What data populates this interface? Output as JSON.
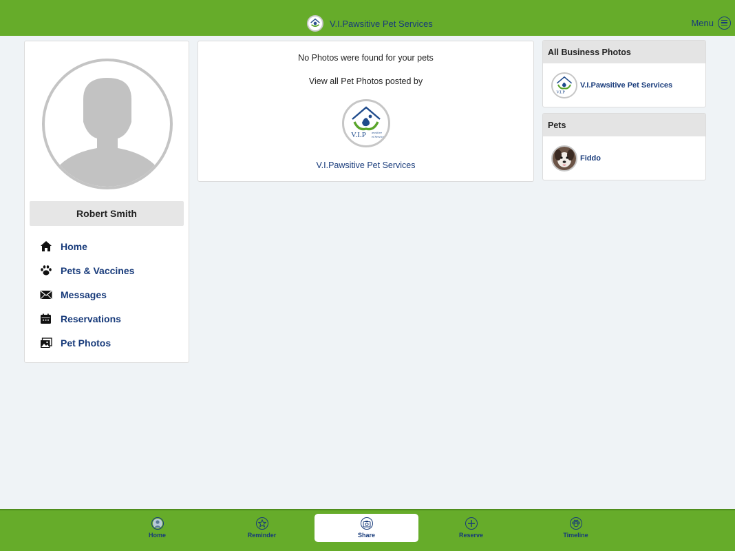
{
  "header": {
    "title": "V.I.Pawsitive Pet Services",
    "logo_icon": "vip-pawsitive-logo-icon",
    "menu_label": "Menu",
    "menu_icon": "hamburger-circle-icon"
  },
  "profile": {
    "name": "Robert Smith",
    "avatar_icon": "default-user-avatar-icon"
  },
  "nav": {
    "items": [
      {
        "label": "Home",
        "icon": "home-icon"
      },
      {
        "label": "Pets & Vaccines",
        "icon": "paw-icon"
      },
      {
        "label": "Messages",
        "icon": "envelope-icon"
      },
      {
        "label": "Reservations",
        "icon": "calendar-icon"
      },
      {
        "label": "Pet Photos",
        "icon": "photos-icon"
      }
    ]
  },
  "photos": {
    "empty_message": "No Photos were found for your pets",
    "view_all_label": "View all Pet Photos posted by",
    "business_name": "V.I.Pawsitive Pet Services",
    "logo_text": "V.I.P",
    "logo_subtext": "awsitive",
    "logo_subtext2": "et Services"
  },
  "business_panel": {
    "title": "All Business Photos",
    "items": [
      {
        "label": "V.I.Pawsitive Pet Services"
      }
    ]
  },
  "pets_panel": {
    "title": "Pets",
    "items": [
      {
        "label": "Fiddo"
      }
    ]
  },
  "bottom_tabs": [
    {
      "label": "Home",
      "icon": "user-circle-icon"
    },
    {
      "label": "Reminder",
      "icon": "star-icon"
    },
    {
      "label": "Share",
      "icon": "camera-icon",
      "active": true
    },
    {
      "label": "Reserve",
      "icon": "plus-icon"
    },
    {
      "label": "Timeline",
      "icon": "paw-circle-icon"
    }
  ],
  "colors": {
    "brand_green": "#66ac2a",
    "link_blue": "#173a7a",
    "background": "#eff3f6"
  }
}
